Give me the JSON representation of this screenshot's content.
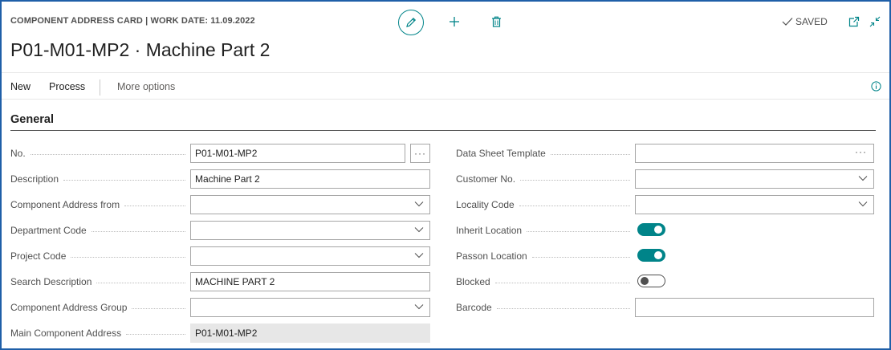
{
  "header": {
    "caption": "COMPONENT ADDRESS CARD | WORK DATE: 11.09.2022",
    "title": "P01-M01-MP2 · Machine Part 2",
    "saved_label": "SAVED"
  },
  "actions": {
    "new_label": "New",
    "process_label": "Process",
    "more_label": "More options"
  },
  "section": {
    "title": "General"
  },
  "left_fields": [
    {
      "label": "No.",
      "value": "P01-M01-MP2"
    },
    {
      "label": "Description",
      "value": "Machine Part 2"
    },
    {
      "label": "Component Address from",
      "value": ""
    },
    {
      "label": "Department Code",
      "value": ""
    },
    {
      "label": "Project Code",
      "value": ""
    },
    {
      "label": "Search Description",
      "value": "MACHINE PART 2"
    },
    {
      "label": "Component Address Group",
      "value": ""
    },
    {
      "label": "Main Component Address",
      "value": "P01-M01-MP2"
    }
  ],
  "right_fields": [
    {
      "label": "Data Sheet Template",
      "value": ""
    },
    {
      "label": "Customer No.",
      "value": ""
    },
    {
      "label": "Locality Code",
      "value": ""
    },
    {
      "label": "Inherit Location",
      "toggle": true
    },
    {
      "label": "Passon Location",
      "toggle": true
    },
    {
      "label": "Blocked",
      "toggle": false
    },
    {
      "label": "Barcode",
      "value": ""
    }
  ],
  "icons": {
    "edit": "pencil-icon",
    "add": "plus-icon",
    "delete": "trash-icon",
    "saved": "checkmark-icon",
    "open_new": "open-in-new-window-icon",
    "collapse": "collapse-icon",
    "info": "info-icon",
    "dropdown": "chevron-down-icon",
    "assist": "ellipsis-icon"
  },
  "colors": {
    "accent": "#008489",
    "frame": "#1f5fa8"
  }
}
